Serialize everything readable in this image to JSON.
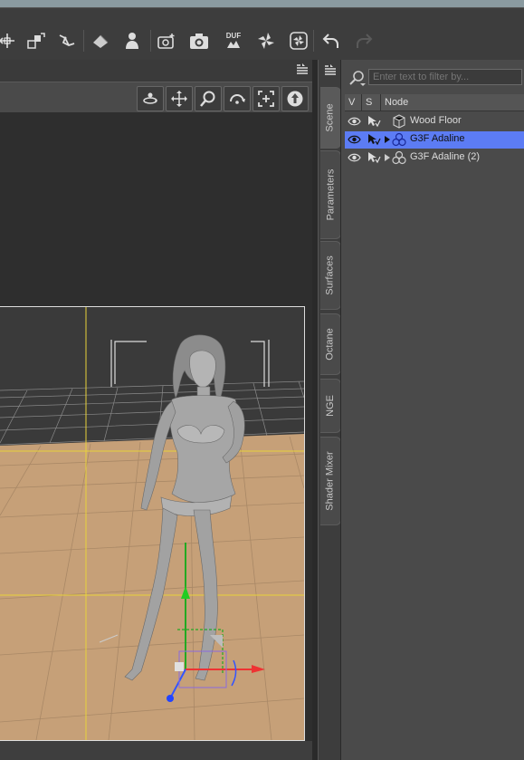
{
  "toolbar": {
    "icons": [
      "transform-tool-icon",
      "node-tool-icon",
      "joint-tool-icon",
      "surface-tool-icon",
      "figure-select-icon",
      "camera-add-icon",
      "render-icon",
      "duf-export-icon",
      "flower-render-icon",
      "octane-render-icon",
      "undo-icon",
      "redo-icon"
    ],
    "duf_label": "DUF"
  },
  "viewport": {
    "nav_icons": [
      "orbit-icon",
      "pan-icon",
      "zoom-icon",
      "rotate-icon",
      "frame-icon",
      "aim-icon"
    ]
  },
  "side_tabs": [
    {
      "label": "Scene",
      "active": true
    },
    {
      "label": "Parameters",
      "active": false
    },
    {
      "label": "Surfaces",
      "active": false
    },
    {
      "label": "Octane",
      "active": false
    },
    {
      "label": "NGE",
      "active": false
    },
    {
      "label": "Shader Mixer",
      "active": false
    }
  ],
  "scene_panel": {
    "search_placeholder": "Enter text to filter by...",
    "columns": {
      "v": "V",
      "s": "S",
      "node": "Node"
    },
    "nodes": [
      {
        "label": "Wood Floor",
        "type": "prop",
        "selected": false,
        "expandable": false
      },
      {
        "label": "G3F Adaline",
        "type": "figure",
        "selected": true,
        "expandable": true
      },
      {
        "label": "G3F Adaline (2)",
        "type": "figure",
        "selected": false,
        "expandable": true
      }
    ]
  },
  "colors": {
    "selection": "#5c7cf4",
    "floor": "#c6a078",
    "guide_lines": "#e8d23a"
  }
}
